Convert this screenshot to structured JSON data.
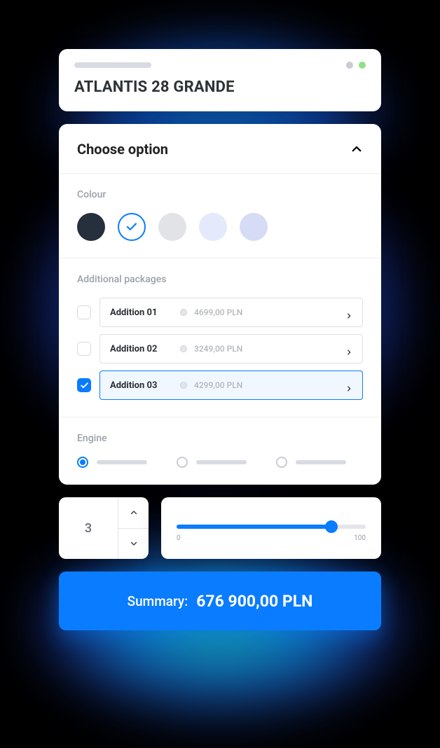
{
  "header": {
    "title": "ATLANTIS 28 GRANDE",
    "status_dots": {
      "grey": "#c9ccd1",
      "green": "#8fe089"
    }
  },
  "options": {
    "heading": "Choose option",
    "colour": {
      "label": "Colour",
      "swatches": [
        "#262f3c",
        "selected-check",
        "#e1e3e7",
        "#e4e9fb",
        "#d6dcf6"
      ]
    },
    "packages": {
      "label": "Additional packages",
      "items": [
        {
          "name": "Addition 01",
          "price": "4699,00 PLN",
          "checked": false
        },
        {
          "name": "Addition 02",
          "price": "3249,00 PLN",
          "checked": false
        },
        {
          "name": "Addition 03",
          "price": "4299,00 PLN",
          "checked": true
        }
      ]
    },
    "engine": {
      "label": "Engine",
      "selected_index": 0,
      "option_count": 3
    }
  },
  "stepper": {
    "value": "3"
  },
  "slider": {
    "min": "0",
    "max": "100",
    "value_pct": 82
  },
  "summary": {
    "label": "Summary:",
    "value": "676 900,00 PLN"
  },
  "colors": {
    "accent": "#0a7cff"
  }
}
